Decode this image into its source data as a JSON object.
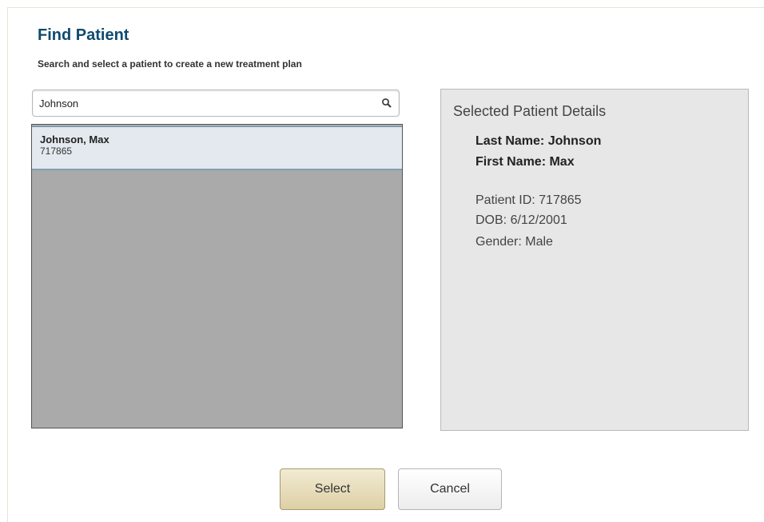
{
  "header": {
    "title": "Find Patient",
    "subtitle": "Search and select a patient to create a new treatment plan"
  },
  "search": {
    "value": "Johnson",
    "icon": "search-icon"
  },
  "results": [
    {
      "name": "Johnson, Max",
      "id": "717865",
      "selected": true
    }
  ],
  "details": {
    "heading": "Selected Patient Details",
    "last_name": "Last Name: Johnson",
    "first_name": "First Name: Max",
    "patient_id": "Patient ID:  717865",
    "dob": "DOB: 6/12/2001",
    "gender": "Gender: Male"
  },
  "buttons": {
    "select_label": "Select",
    "cancel_label": "Cancel"
  },
  "colors": {
    "title": "#0f4a6e",
    "selected_row": "#e3e9ee",
    "list_background": "#a9aaa9",
    "details_background": "#e7e7e7",
    "select_button": "#ddd0a6"
  }
}
